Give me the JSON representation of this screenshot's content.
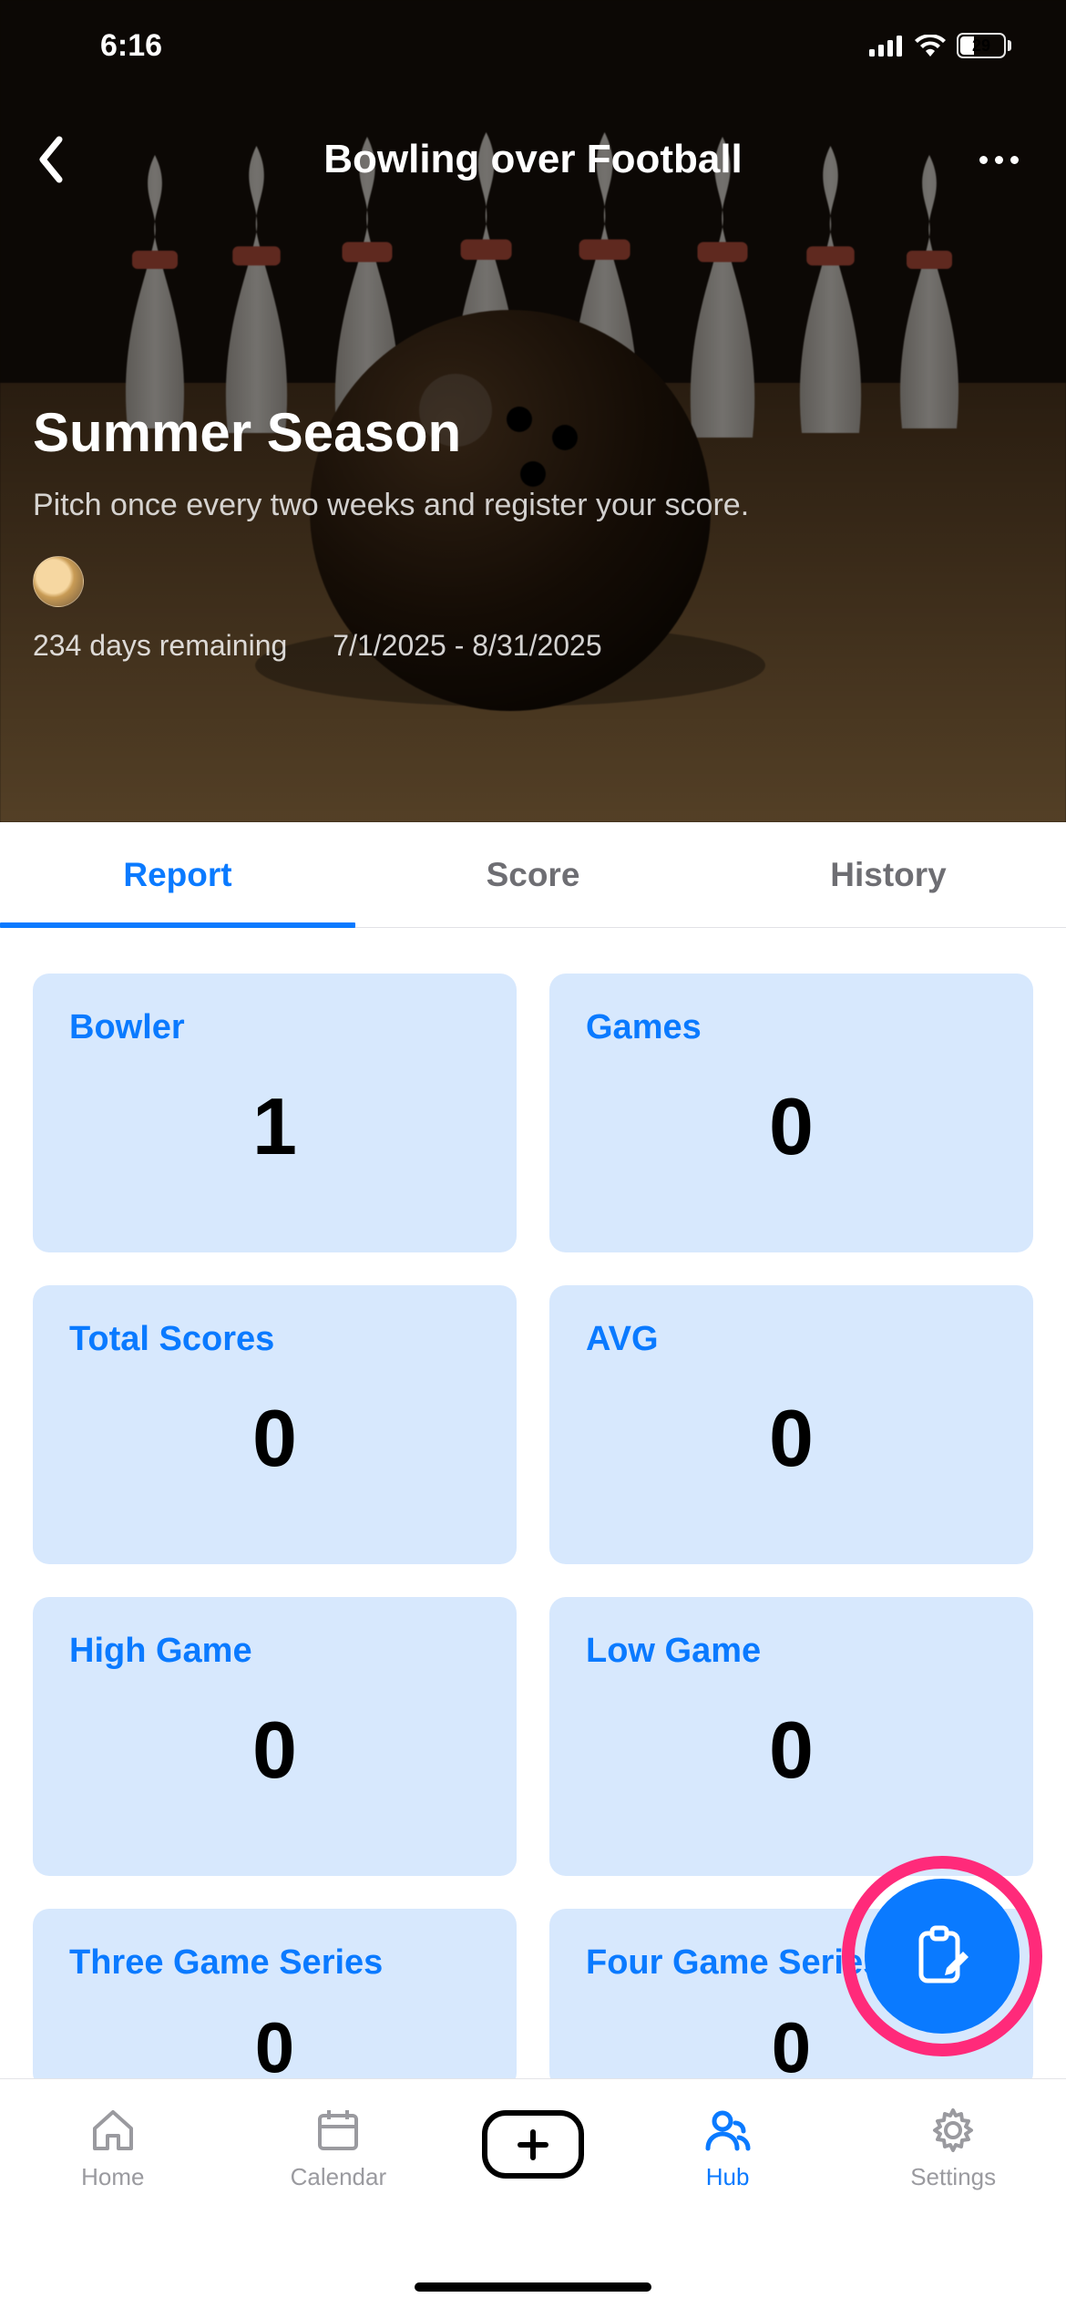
{
  "status": {
    "time": "6:16",
    "battery": "29"
  },
  "header": {
    "title": "Bowling over Football"
  },
  "hero": {
    "season_title": "Summer Season",
    "description": "Pitch once every two weeks and register your score.",
    "days_remaining": "234 days remaining",
    "date_range": "7/1/2025 - 8/31/2025"
  },
  "tabs": [
    {
      "label": "Report",
      "active": true
    },
    {
      "label": "Score",
      "active": false
    },
    {
      "label": "History",
      "active": false
    }
  ],
  "stats": [
    {
      "label": "Bowler",
      "value": "1"
    },
    {
      "label": "Games",
      "value": "0"
    },
    {
      "label": "Total Scores",
      "value": "0"
    },
    {
      "label": "AVG",
      "value": "0"
    },
    {
      "label": "High Game",
      "value": "0"
    },
    {
      "label": "Low Game",
      "value": "0"
    },
    {
      "label": "Three Game Series",
      "value": "0"
    },
    {
      "label": "Four Game Series",
      "value": "0"
    }
  ],
  "tabbar": [
    {
      "label": "Home",
      "icon": "home-icon",
      "active": false
    },
    {
      "label": "Calendar",
      "icon": "calendar-icon",
      "active": false
    },
    {
      "label": "",
      "icon": "plus-icon",
      "active": false
    },
    {
      "label": "Hub",
      "icon": "people-icon",
      "active": true
    },
    {
      "label": "Settings",
      "icon": "gear-icon",
      "active": false
    }
  ],
  "fab": {
    "icon": "clipboard-edit-icon"
  },
  "colors": {
    "accent": "#0a7aff",
    "card_bg": "#d7e8fd",
    "ring": "#ff2a7a"
  }
}
